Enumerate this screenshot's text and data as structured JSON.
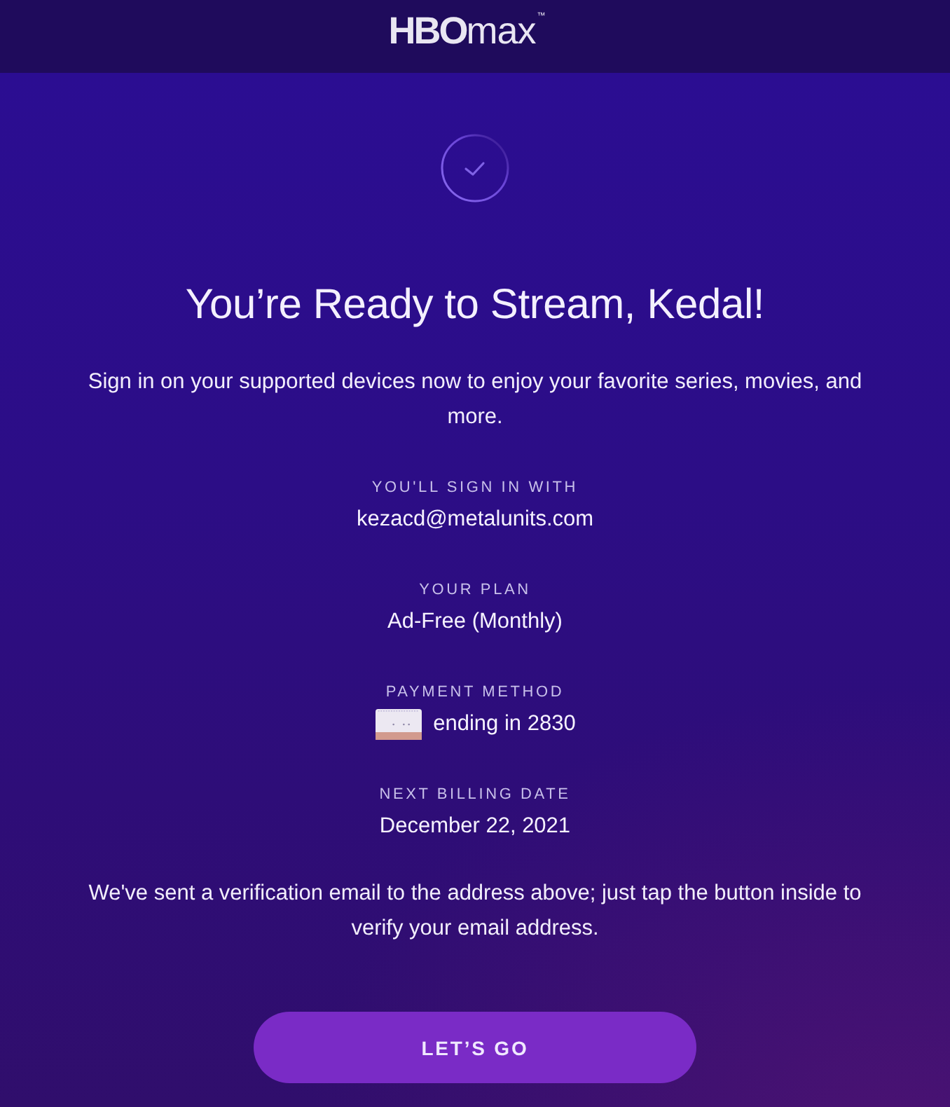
{
  "header": {
    "logo": "**HBO**max$^{™}$"
  },
  "confirmation": {
    "title": "You’re Ready to Stream, Kedal!",
    "intro": "Sign in on your supported devices now to enjoy your favorite series, movies, and more.",
    "details": [
      {
        "kind": "text",
        "label": "YOU'LL SIGN IN WITH",
        "value": "kezacd@metalunits.com"
      },
      {
        "kind": "text",
        "label": "YOUR PLAN",
        "value": "Ad-Free (Monthly)"
      },
      {
        "kind": "card",
        "label": "PAYMENT METHOD",
        "value": "ending in 2830"
      },
      {
        "kind": "text",
        "label": "NEXT BILLING DATE",
        "value": "December 22, 2021"
      }
    ],
    "note": "We've sent a verification email to the address above; just tap the button inside to verify your email address.",
    "button": "LET’S GO"
  }
}
